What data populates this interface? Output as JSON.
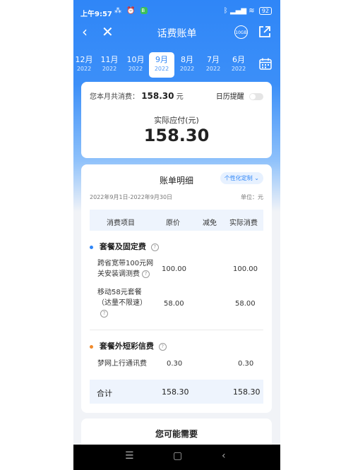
{
  "status_bar": {
    "time": "上午9:57",
    "battery": "92"
  },
  "header": {
    "title": "话费账单",
    "badge_10g": "10GB"
  },
  "months": [
    {
      "month": "12月",
      "year": "2022"
    },
    {
      "month": "11月",
      "year": "2022"
    },
    {
      "month": "10月",
      "year": "2022"
    },
    {
      "month": "9月",
      "year": "2022"
    },
    {
      "month": "8月",
      "year": "2022"
    },
    {
      "month": "7月",
      "year": "2022"
    },
    {
      "month": "6月",
      "year": "2022"
    }
  ],
  "selected_month": "9月",
  "summary": {
    "consumption_label": "您本月共消费：",
    "consumption_amount": "158.30",
    "consumption_unit": "元",
    "reminder_label": "日历提醒",
    "reminder_on": false,
    "pay_label": "实际应付(元)",
    "pay_amount": "158.30"
  },
  "detail": {
    "title": "账单明细",
    "custom_label": "个性化定制",
    "date_range": "2022年9月1日-2022年9月30日",
    "unit": "单位：元",
    "columns": [
      "消费项目",
      "原价",
      "减免",
      "实际消费"
    ],
    "sections": [
      {
        "name": "套餐及固定费",
        "dot_color": "#2f86f7",
        "items": [
          {
            "line1": "跨省宽带100元网",
            "line2": "关安装调测费",
            "price": "100.00",
            "discount": "",
            "actual": "100.00"
          },
          {
            "line1": "移动58元套餐",
            "line2": "（达量不限速）",
            "price": "58.00",
            "discount": "",
            "actual": "58.00"
          }
        ]
      },
      {
        "name": "套餐外短彩信费",
        "dot_color": "#f08a2c",
        "items": [
          {
            "line1": "梦网上行通讯费",
            "line2": "",
            "price": "0.30",
            "discount": "",
            "actual": "0.30"
          }
        ]
      }
    ],
    "total": {
      "label": "合计",
      "price": "158.30",
      "actual": "158.30"
    }
  },
  "maybe_need": {
    "title": "您可能需要"
  },
  "colors": {
    "primary": "#2f86f7",
    "accent_orange": "#f08a2c"
  }
}
